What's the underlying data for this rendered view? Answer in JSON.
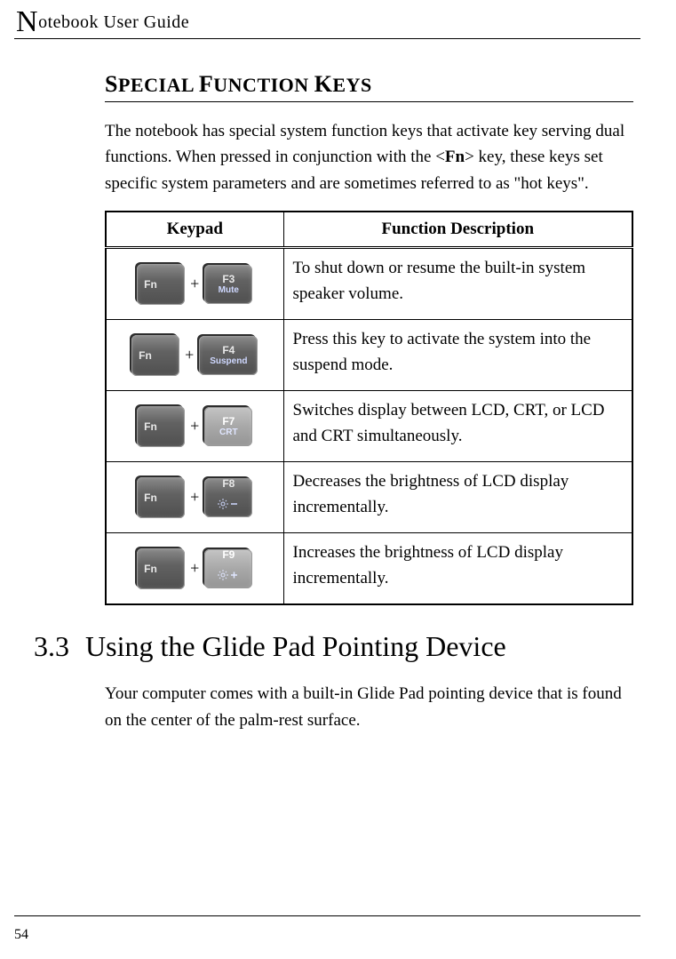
{
  "running_head": {
    "dropcap": "N",
    "rest": "otebook User Guide"
  },
  "heading_parts": {
    "p0": "S",
    "p1": "PECIAL ",
    "p2": "F",
    "p3": "UNCTION ",
    "p4": "K",
    "p5": "EYS"
  },
  "intro": {
    "pre": "The notebook has special system function keys that activate key serving dual functions. When pressed in conjunction with the <",
    "fn": "Fn",
    "post": "> key, these keys set specific system parameters and are sometimes referred to as \"hot keys\"."
  },
  "table": {
    "head_keypad": "Keypad",
    "head_desc": "Function Description",
    "rows": [
      {
        "fkey_top": "F3",
        "fkey_bottom": "Mute",
        "wide": false,
        "light": false,
        "desc": "To shut down or resume the built-in system speaker volume."
      },
      {
        "fkey_top": "F4",
        "fkey_bottom": "Suspend",
        "wide": true,
        "light": false,
        "desc": "Press this key to activate the system into the suspend mode."
      },
      {
        "fkey_top": "F7",
        "fkey_bottom": "CRT",
        "wide": false,
        "light": true,
        "desc": "Switches display between LCD, CRT, or LCD and CRT simultaneously."
      },
      {
        "fkey_top": "F8",
        "fkey_bottom": "brightness-down",
        "svg": true,
        "wide": false,
        "light": false,
        "desc": "Decreases the brightness of LCD display incrementally."
      },
      {
        "fkey_top": "F9",
        "fkey_bottom": "brightness-up",
        "svg": true,
        "wide": false,
        "light": true,
        "desc": "Increases the brightness of LCD display incrementally."
      }
    ],
    "plus": "+",
    "fn_label": "Fn"
  },
  "section": {
    "num": "3.3",
    "title": "Using the Glide Pad Pointing Device"
  },
  "section_para": "Your computer comes with a built-in Glide Pad pointing device that is found on the center of the palm-rest surface.",
  "page_number": "54"
}
